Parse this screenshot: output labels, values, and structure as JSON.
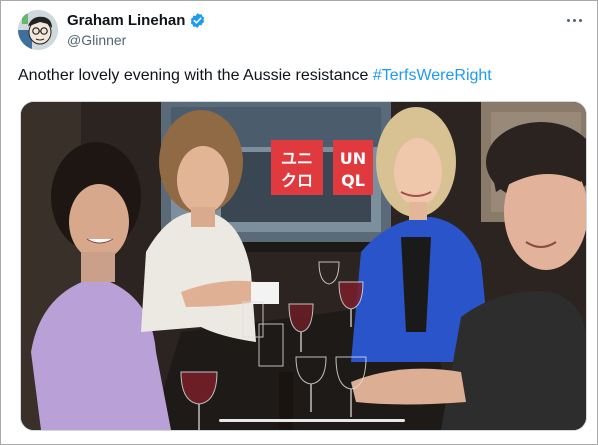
{
  "author": {
    "name": "Graham Linehan",
    "handle": "@Glinner",
    "verified_icon": "verified-badge-icon",
    "avatar_icon": "cartoon-avatar-icon"
  },
  "tweet": {
    "text": "Another lovely evening with the Aussie resistance ",
    "hashtag": "#TerfsWereRight"
  },
  "store_sign": {
    "left_panel": [
      "ユニ",
      "クロ"
    ],
    "right_panel": [
      "UN",
      "QL"
    ]
  },
  "colors": {
    "hashtag": "#1d9bf0",
    "verified": "#1d9bf0",
    "sign_red": "#e03a3e"
  },
  "menu_icon": "more-options-icon"
}
